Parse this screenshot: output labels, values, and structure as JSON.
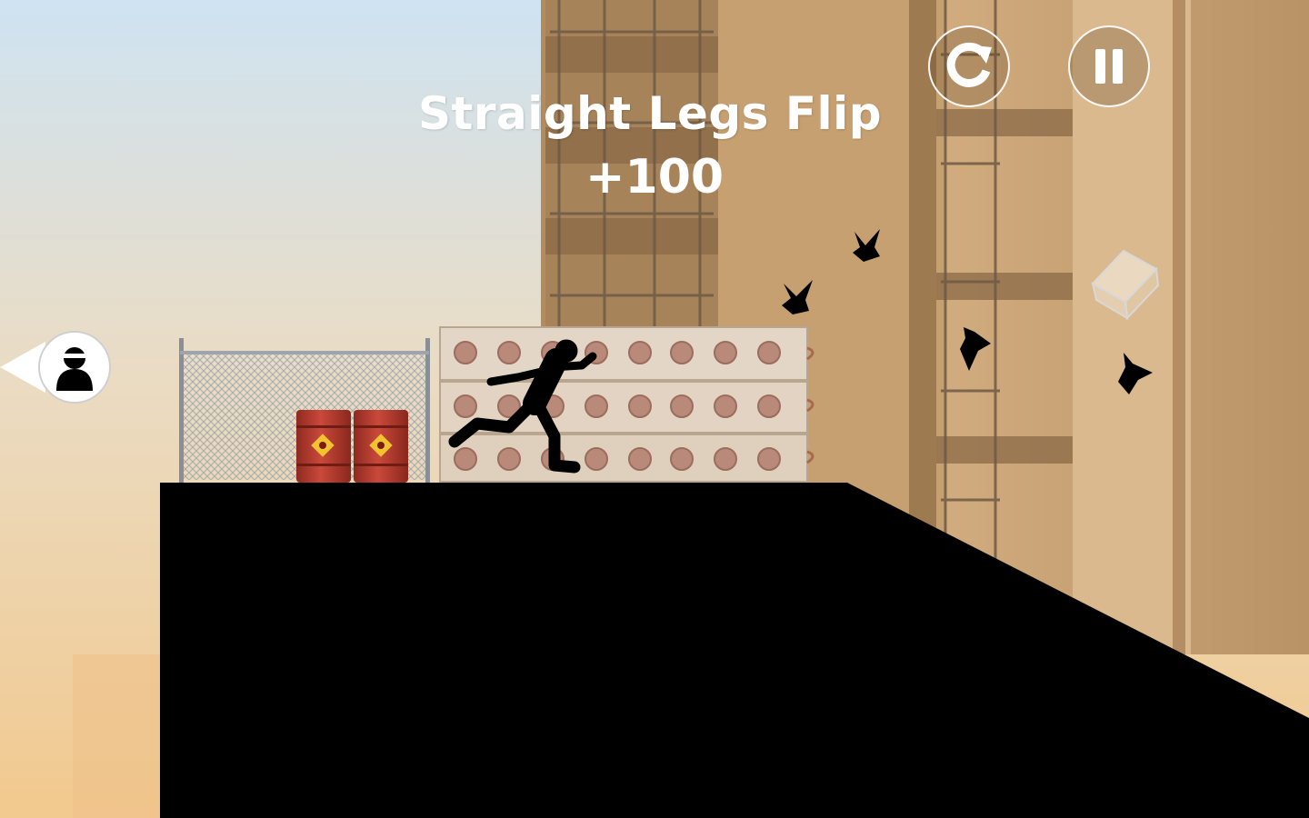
{
  "hud": {
    "restart": {
      "icon": "restart-icon"
    },
    "pause": {
      "icon": "pause-icon"
    }
  },
  "trick": {
    "name": "Straight Legs Flip",
    "points": "+100"
  },
  "chaser_indicator": {
    "icon": "hunter-silhouette-icon",
    "direction": "left"
  },
  "colors": {
    "sky_top": "#cfe3f2",
    "sky_bottom": "#f2cf97",
    "building": "#c9a477",
    "building_dark": "#a17a4e",
    "silhouette": "#000000",
    "barrel": "#b83a2c",
    "hud_text": "#ffffff"
  }
}
